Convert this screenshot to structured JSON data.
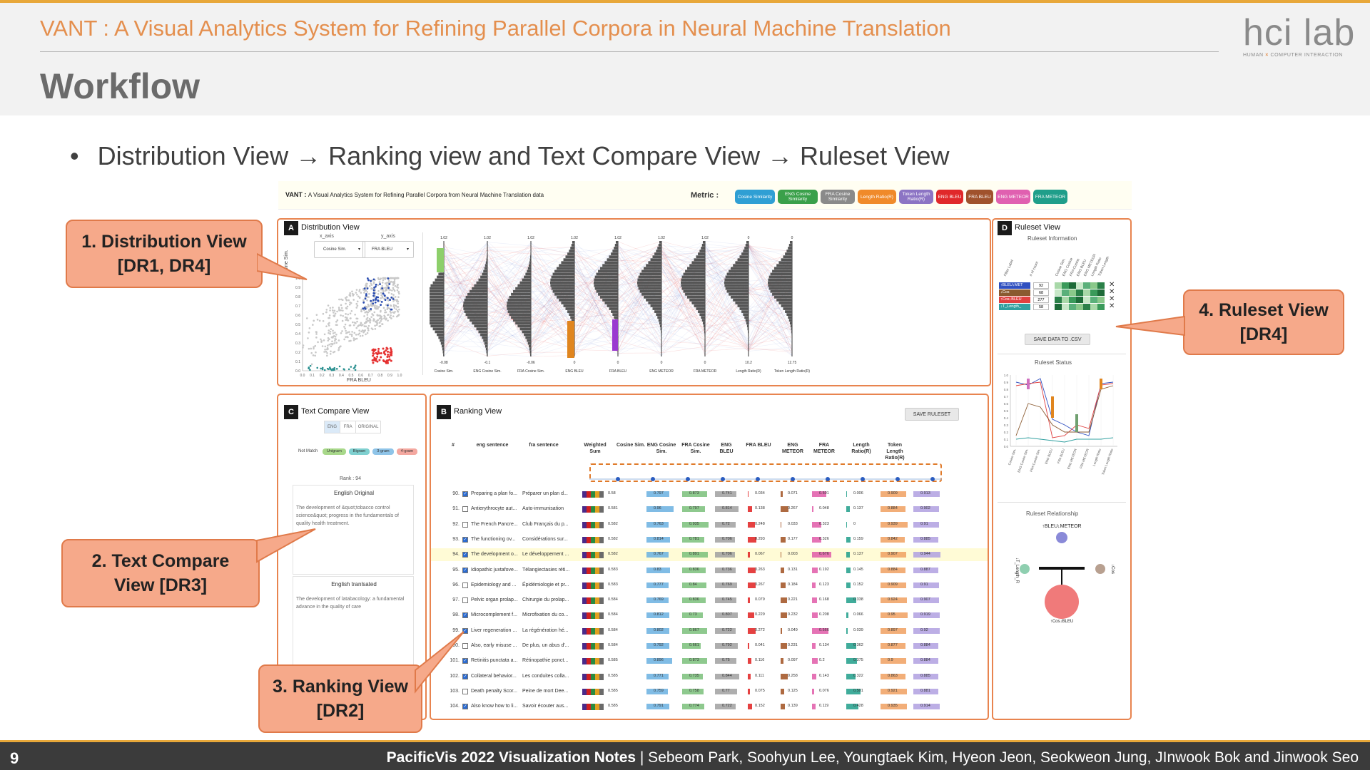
{
  "slide": {
    "subtitle": "VANT : A Visual Analytics System for Refining Parallel Corpora in Neural Machine Translation",
    "title": "Workflow",
    "bullet": "Distribution View → Ranking view and Text Compare View → Ruleset View",
    "logo_main": "hci lab",
    "logo_sub_left": "HUMAN",
    "logo_sub_x": "×",
    "logo_sub_right": "COMPUTER INTERACTION",
    "page_number": "9",
    "footer_bold": "PacificVis 2022 Visualization Notes",
    "footer_authors": " | Sebeom Park, Soohyun Lee, Youngtaek Kim, Hyeon Jeon, Seokweon Jung, JInwook Bok and Jinwook Seo"
  },
  "callouts": {
    "c1": "1. Distribution View\n[DR1, DR4]",
    "c2": "2. Text Compare\nView [DR3]",
    "c3": "3. Ranking View\n[DR2]",
    "c4": "4. Ruleset View\n[DR4]"
  },
  "app": {
    "title_bold": "VANT : ",
    "title_rest": "A Visual Analytics System for Refining Parallel Corpora from Neural Machine Translation data",
    "metric_label": "Metric :",
    "metrics": [
      {
        "label": "Cosine Similarity",
        "color": "#2f9fd4"
      },
      {
        "label": "ENG Cosine Similarity",
        "color": "#3aa04a"
      },
      {
        "label": "FRA Cosine Similarity",
        "color": "#8a8a8a"
      },
      {
        "label": "Length Ratio(R)",
        "color": "#f08a2a"
      },
      {
        "label": "Token Length Ratio(R)",
        "color": "#8c74c4"
      },
      {
        "label": "ENG BLEU",
        "color": "#e0282a"
      },
      {
        "label": "FRA BLEU",
        "color": "#a0522d"
      },
      {
        "label": "ENG METEOR",
        "color": "#e060b0"
      },
      {
        "label": "FRA METEOR",
        "color": "#1f9e8a"
      }
    ],
    "distribution": {
      "tag": "A",
      "title": "Distribution View",
      "x_axis_label": "x_axis",
      "y_axis_label": "y_axis",
      "x_axis_value": "Cosine Sim.",
      "y_axis_value": "FRA BLEU",
      "scatter_xlabel": "FRA BLEU",
      "scatter_ylabel": "Cosine Sim.",
      "y_ticks": [
        "1.0",
        "0.9",
        "0.8",
        "0.7",
        "0.6",
        "0.5",
        "0.4",
        "0.3",
        "0.2",
        "0.1",
        "0.0"
      ],
      "x_ticks": [
        "0.0",
        "0.1",
        "0.2",
        "0.3",
        "0.4",
        "0.5",
        "0.6",
        "0.7",
        "0.8",
        "0.9",
        "1.0"
      ],
      "pc_axes": [
        {
          "label": "Cosine Sim.",
          "top": "1.02",
          "bottom": "-0.08"
        },
        {
          "label": "ENG Cosine Sim.",
          "top": "1.02",
          "bottom": "-0.1"
        },
        {
          "label": "FRA Cosine Sim.",
          "top": "1.02",
          "bottom": "-0.06"
        },
        {
          "label": "ENG BLEU",
          "top": "1.02",
          "bottom": "0"
        },
        {
          "label": "FRA BLEU",
          "top": "1.02",
          "bottom": "0"
        },
        {
          "label": "ENG METEOR",
          "top": "1.02",
          "bottom": "0"
        },
        {
          "label": "FRA METEOR",
          "top": "1.02",
          "bottom": "0"
        },
        {
          "label": "Length Ratio(R)",
          "top": "0",
          "bottom": "10.2"
        },
        {
          "label": "Token Length Ratio(R)",
          "top": "0",
          "bottom": "12.75"
        }
      ]
    },
    "text_compare": {
      "tag": "C",
      "title": "Text Compare View",
      "tabs": [
        "ENG",
        "FRA",
        "ORIGINAL"
      ],
      "match_label": "Not Match",
      "ngrams": [
        {
          "label": "Unigram",
          "color": "#a8d88a"
        },
        {
          "label": "Bigram",
          "color": "#7fd0d0"
        },
        {
          "label": "3-gram",
          "color": "#8fc4e8"
        },
        {
          "label": "4-gram",
          "color": "#f4a8a0"
        }
      ],
      "rank": "Rank : 94",
      "original_title": "English Original",
      "original_text": "The development of &quot;tobacco control science&quot; progress in the fundamentals of quality health treatment.",
      "translated_title": "English tranlsated",
      "translated_text": "The development of latabacology: a fundamental advance in the quality of care"
    },
    "ranking": {
      "tag": "B",
      "title": "Ranking View",
      "save_ruleset": "SAVE RULESET",
      "headers": [
        "#",
        "eng sentence",
        "fra sentence",
        "Weighted Sum",
        "Cosine Sim.",
        "ENG Cosine Sim.",
        "FRA Cosine Sim.",
        "ENG BLEU",
        "FRA BLEU",
        "ENG METEOR",
        "FRA METEOR",
        "Length Ratio(R)",
        "Token Length Ratio(R)"
      ],
      "rows": [
        {
          "n": "90.",
          "checked": true,
          "eng": "Preparing a plan fo...",
          "fra": "Préparer un plan d...",
          "v": [
            "0.58",
            "0.797",
            "0.873",
            "0.741",
            "0.034",
            "0.071",
            "0.501",
            "0.006",
            "0.909",
            "0.913"
          ]
        },
        {
          "n": "91.",
          "checked": false,
          "eng": "Antierythrocyte aut...",
          "fra": "Auto-immunisation",
          "v": [
            "0.581",
            "0.96",
            "0.797",
            "0.814",
            "0.138",
            "0.267",
            "0.048",
            "0.137",
            "0.884",
            "0.902"
          ]
        },
        {
          "n": "92.",
          "checked": false,
          "eng": "The French Pancre...",
          "fra": "Club Français du p...",
          "v": [
            "0.582",
            "0.763",
            "0.935",
            "0.72",
            "0.248",
            "0.033",
            "0.323",
            "0",
            "0.939",
            "0.91"
          ]
        },
        {
          "n": "93.",
          "checked": true,
          "eng": "The functioning ov...",
          "fra": "Considérations sur...",
          "v": [
            "0.582",
            "0.814",
            "0.781",
            "0.706",
            "0.293",
            "0.177",
            "0.326",
            "0.159",
            "0.842",
            "0.885"
          ]
        },
        {
          "n": "94.",
          "checked": true,
          "eng": "The development o...",
          "fra": "Le développement ...",
          "v": [
            "0.582",
            "0.767",
            "0.891",
            "0.706",
            "0.067",
            "0.003",
            "0.676",
            "0.137",
            "0.907",
            "0.944"
          ]
        },
        {
          "n": "95.",
          "checked": true,
          "eng": "Idiopathic juxtafove...",
          "fra": "Télangiectasies réti...",
          "v": [
            "0.583",
            "0.83",
            "0.836",
            "0.736",
            "0.263",
            "0.131",
            "0.192",
            "0.145",
            "0.884",
            "0.887"
          ]
        },
        {
          "n": "96.",
          "checked": false,
          "eng": "Epidemiology and ...",
          "fra": "Épidémiologie et pr...",
          "v": [
            "0.583",
            "0.777",
            "0.84",
            "0.769",
            "0.267",
            "0.184",
            "0.123",
            "0.152",
            "0.909",
            "0.91"
          ]
        },
        {
          "n": "97.",
          "checked": false,
          "eng": "Pelvic organ prolap...",
          "fra": "Chirurgie du prolap...",
          "v": [
            "0.584",
            "0.769",
            "0.836",
            "0.745",
            "0.079",
            "0.221",
            "0.168",
            "0.338",
            "0.924",
            "0.907"
          ]
        },
        {
          "n": "98.",
          "checked": true,
          "eng": "Microcomplement f...",
          "fra": "Microfixation du co...",
          "v": [
            "0.584",
            "0.812",
            "0.73",
            "0.807",
            "0.229",
            "0.232",
            "0.208",
            "0.066",
            "0.95",
            "0.919"
          ]
        },
        {
          "n": "99.",
          "checked": true,
          "eng": "Liver regeneration ...",
          "fra": "La régénération hé...",
          "v": [
            "0.584",
            "0.802",
            "0.867",
            "0.722",
            "0.272",
            "0.049",
            "0.566",
            "0.039",
            "0.897",
            "0.92"
          ]
        },
        {
          "n": "100.",
          "checked": false,
          "eng": "Also, early misuse ...",
          "fra": "De plus, un abus d'...",
          "v": [
            "0.584",
            "0.792",
            "0.661",
            "0.792",
            "0.041",
            "0.231",
            "0.134",
            "0.362",
            "0.877",
            "0.884"
          ]
        },
        {
          "n": "101.",
          "checked": true,
          "eng": "Retinitis punctata a...",
          "fra": "Rétinopathie ponct...",
          "v": [
            "0.585",
            "0.896",
            "0.873",
            "0.75",
            "0.116",
            "0.097",
            "0.2",
            "0.375",
            "0.9",
            "0.884"
          ]
        },
        {
          "n": "102.",
          "checked": true,
          "eng": "Collateral behavior...",
          "fra": "Les conduites colla...",
          "v": [
            "0.585",
            "0.771",
            "0.735",
            "0.844",
            "0.111",
            "0.258",
            "0.143",
            "0.322",
            "0.863",
            "0.885"
          ]
        },
        {
          "n": "103.",
          "checked": false,
          "eng": "Death penalty Scor...",
          "fra": "Peine de mort Dee...",
          "v": [
            "0.585",
            "0.759",
            "0.758",
            "0.77",
            "0.075",
            "0.125",
            "0.076",
            "0.501",
            "0.921",
            "0.881"
          ]
        },
        {
          "n": "104.",
          "checked": true,
          "eng": "Also know how to li...",
          "fra": "Savoir écouter aus...",
          "v": [
            "0.585",
            "0.791",
            "0.774",
            "0.722",
            "0.152",
            "0.139",
            "0.119",
            "0.428",
            "0.935",
            "0.914"
          ]
        }
      ]
    },
    "ruleset": {
      "tag": "D",
      "title": "Ruleset View",
      "info_title": "Ruleset Information",
      "col_headers": [
        "Filter Label",
        "# of count",
        "Cosine Sim.",
        "ENG Cosine",
        "FRA Cosine",
        "ENG BLEU",
        "ENG METEOR",
        "Length Ratio",
        "Token Length"
      ],
      "rules": [
        {
          "label": "↑BLEU↓MET",
          "count": "92",
          "color": "#3050c0"
        },
        {
          "label": "↓Cos",
          "count": "68",
          "color": "#8a5a30"
        },
        {
          "label": "↑Cos↓BLEU",
          "count": "277",
          "color": "#e04040"
        },
        {
          "label": "↓T_Length_",
          "count": "58",
          "color": "#30a0a0"
        }
      ],
      "save_csv": "SAVE DATA TO .CSV",
      "status_title": "Ruleset Status",
      "status_y_ticks": [
        "1.0",
        "0.9",
        "0.8",
        "0.7",
        "0.6",
        "0.5",
        "0.4",
        "0.3",
        "0.2",
        "0.1",
        "0.0"
      ],
      "status_x_labels": [
        "Cosine Sim.",
        "ENG Cosine Sim.",
        "FRA Cosine Sim.",
        "ENG BLEU",
        "FRA BLEU",
        "ENG METEOR",
        "FRA METEOR",
        "Length Ratio",
        "Token Length Ratio"
      ],
      "relationship_title": "Ruleset Relationship",
      "nodes": {
        "top": "↑BLEU↓METEOR",
        "left": "↓T_Length_R",
        "right": "↓Cos",
        "bottom": "↑Cos↓BLEU"
      }
    }
  }
}
